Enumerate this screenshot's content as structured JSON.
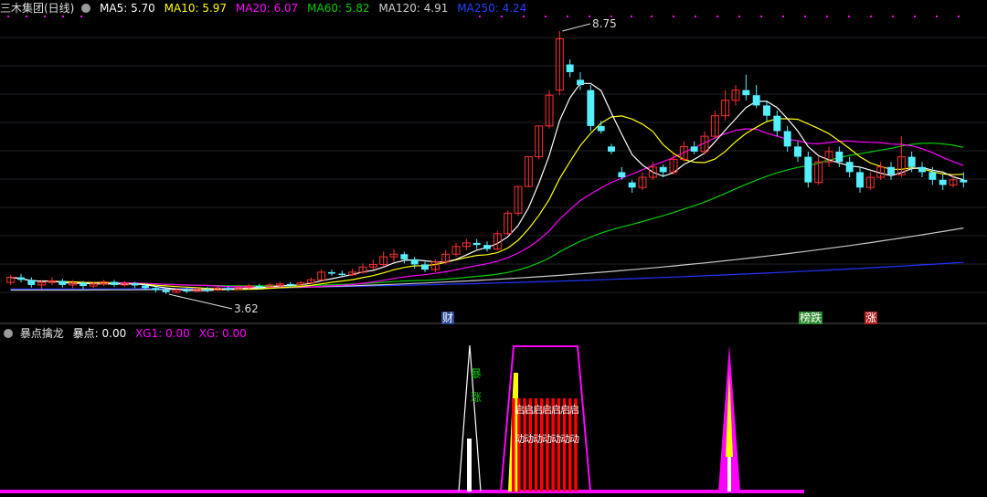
{
  "colors": {
    "ma5": "#ffffff",
    "ma10": "#ffff00",
    "ma20": "#ff00ff",
    "ma60": "#00cc00",
    "ma120": "#c8c8c8",
    "ma250": "#2233ff",
    "up_candle": "#ff3030",
    "down_candle": "#55eeff",
    "indicator_main": "#ff00ff",
    "indicator_bars": "#ff0000"
  },
  "header": {
    "stock_name": "三木集团(日线)",
    "ma5": "MA5: 5.70",
    "ma10": "MA10: 5.97",
    "ma20": "MA20: 6.07",
    "ma60": "MA60: 5.82",
    "ma120": "MA120: 4.91",
    "ma250": "MA250: 4.24"
  },
  "price_panel": {
    "high_label": "8.75",
    "low_label": "3.62",
    "event_tags": [
      "财",
      "榜跌",
      "涨"
    ]
  },
  "indicator_header": {
    "name": "暴点擒龙",
    "v1": "暴点: 0.00",
    "v2": "XG1: 0.00",
    "v3": "XG: 0.00"
  },
  "indicator_texts": {
    "vertical_top": "暴",
    "vertical_bottom": "涨",
    "qi_row": "启启启启启启启",
    "dong_row": "动动动动动动动"
  },
  "chart_data": [
    {
      "type": "candlestick",
      "title": "三木集团(日线)",
      "high_marker": 8.75,
      "low_marker": 3.62,
      "ylim": [
        3.3,
        9.0
      ],
      "series": [
        {
          "name": "MA5",
          "last": 5.7
        },
        {
          "name": "MA10",
          "last": 5.97
        },
        {
          "name": "MA20",
          "last": 6.07
        },
        {
          "name": "MA60",
          "last": 5.82
        },
        {
          "name": "MA120",
          "last": 4.91
        },
        {
          "name": "MA250",
          "last": 4.24
        }
      ],
      "candles": [
        [
          3.85,
          3.95,
          4.0,
          3.8
        ],
        [
          3.95,
          3.9,
          4.02,
          3.85
        ],
        [
          3.9,
          3.8,
          3.95,
          3.75
        ],
        [
          3.8,
          3.85,
          3.9,
          3.72
        ],
        [
          3.85,
          3.88,
          3.95,
          3.8
        ],
        [
          3.88,
          3.8,
          3.92,
          3.75
        ],
        [
          3.8,
          3.84,
          3.9,
          3.74
        ],
        [
          3.84,
          3.78,
          3.88,
          3.72
        ],
        [
          3.78,
          3.82,
          3.86,
          3.74
        ],
        [
          3.82,
          3.86,
          3.9,
          3.78
        ],
        [
          3.86,
          3.8,
          3.9,
          3.76
        ],
        [
          3.8,
          3.83,
          3.88,
          3.76
        ],
        [
          3.83,
          3.79,
          3.86,
          3.74
        ],
        [
          3.79,
          3.74,
          3.82,
          3.7
        ],
        [
          3.74,
          3.7,
          3.78,
          3.66
        ],
        [
          3.7,
          3.66,
          3.74,
          3.62
        ],
        [
          3.66,
          3.7,
          3.74,
          3.64
        ],
        [
          3.7,
          3.68,
          3.75,
          3.64
        ],
        [
          3.68,
          3.72,
          3.77,
          3.66
        ],
        [
          3.72,
          3.7,
          3.76,
          3.66
        ],
        [
          3.7,
          3.74,
          3.78,
          3.68
        ],
        [
          3.74,
          3.72,
          3.78,
          3.68
        ],
        [
          3.72,
          3.75,
          3.8,
          3.7
        ],
        [
          3.75,
          3.78,
          3.82,
          3.72
        ],
        [
          3.78,
          3.76,
          3.82,
          3.72
        ],
        [
          3.76,
          3.8,
          3.84,
          3.74
        ],
        [
          3.8,
          3.82,
          3.86,
          3.77
        ],
        [
          3.82,
          3.8,
          3.86,
          3.76
        ],
        [
          3.8,
          3.84,
          3.88,
          3.78
        ],
        [
          3.84,
          3.9,
          3.95,
          3.82
        ],
        [
          3.9,
          4.05,
          4.1,
          3.88
        ],
        [
          4.05,
          4.02,
          4.1,
          3.98
        ],
        [
          4.02,
          4.0,
          4.08,
          3.96
        ],
        [
          4.0,
          4.05,
          4.12,
          3.98
        ],
        [
          4.05,
          4.15,
          4.22,
          4.02
        ],
        [
          4.15,
          4.2,
          4.3,
          4.1
        ],
        [
          4.2,
          4.35,
          4.45,
          4.15
        ],
        [
          4.35,
          4.4,
          4.5,
          4.25
        ],
        [
          4.4,
          4.3,
          4.45,
          4.22
        ],
        [
          4.3,
          4.2,
          4.35,
          4.12
        ],
        [
          4.2,
          4.1,
          4.25,
          4.05
        ],
        [
          4.1,
          4.25,
          4.3,
          4.05
        ],
        [
          4.25,
          4.4,
          4.48,
          4.2
        ],
        [
          4.4,
          4.55,
          4.62,
          4.35
        ],
        [
          4.55,
          4.62,
          4.7,
          4.48
        ],
        [
          4.62,
          4.58,
          4.7,
          4.5
        ],
        [
          4.58,
          4.5,
          4.65,
          4.45
        ],
        [
          4.5,
          4.8,
          4.85,
          4.48
        ],
        [
          4.8,
          5.2,
          5.25,
          4.78
        ],
        [
          5.2,
          5.72,
          5.72,
          5.15
        ],
        [
          5.72,
          6.3,
          6.3,
          5.7
        ],
        [
          6.3,
          6.9,
          6.9,
          6.25
        ],
        [
          6.9,
          7.5,
          7.6,
          6.85
        ],
        [
          7.6,
          8.6,
          8.75,
          7.5
        ],
        [
          8.1,
          7.95,
          8.2,
          7.85
        ],
        [
          7.8,
          7.7,
          7.95,
          7.6
        ],
        [
          7.6,
          6.9,
          7.7,
          6.8
        ],
        [
          6.9,
          6.8,
          7.0,
          6.75
        ],
        [
          6.5,
          6.4,
          6.55,
          6.35
        ],
        [
          6.0,
          5.9,
          6.1,
          5.85
        ],
        [
          5.8,
          5.7,
          5.85,
          5.6
        ],
        [
          5.7,
          5.9,
          6.0,
          5.65
        ],
        [
          5.9,
          6.1,
          6.2,
          5.85
        ],
        [
          6.1,
          6.0,
          6.15,
          5.9
        ],
        [
          6.0,
          6.25,
          6.35,
          5.95
        ],
        [
          6.25,
          6.5,
          6.6,
          6.2
        ],
        [
          6.5,
          6.4,
          6.6,
          6.35
        ],
        [
          6.4,
          6.7,
          6.8,
          6.35
        ],
        [
          6.7,
          7.1,
          7.2,
          6.65
        ],
        [
          7.1,
          7.4,
          7.6,
          7.0
        ],
        [
          7.4,
          7.6,
          7.7,
          7.3
        ],
        [
          7.6,
          7.5,
          7.9,
          7.4
        ],
        [
          7.5,
          7.3,
          7.7,
          7.25
        ],
        [
          7.3,
          7.1,
          7.4,
          7.0
        ],
        [
          7.1,
          6.8,
          7.2,
          6.7
        ],
        [
          6.8,
          6.5,
          6.9,
          6.4
        ],
        [
          6.5,
          6.3,
          6.6,
          6.2
        ],
        [
          6.3,
          5.8,
          6.4,
          5.7
        ],
        [
          5.8,
          6.2,
          6.3,
          5.75
        ],
        [
          6.2,
          6.4,
          6.5,
          6.1
        ],
        [
          6.4,
          6.2,
          6.5,
          6.1
        ],
        [
          6.2,
          6.0,
          6.3,
          5.9
        ],
        [
          6.0,
          5.7,
          6.1,
          5.6
        ],
        [
          5.7,
          5.9,
          6.0,
          5.65
        ],
        [
          5.9,
          6.1,
          6.2,
          5.85
        ],
        [
          6.1,
          5.95,
          6.2,
          5.85
        ],
        [
          5.95,
          6.3,
          6.7,
          5.9
        ],
        [
          6.3,
          6.1,
          6.4,
          6.0
        ],
        [
          6.1,
          6.0,
          6.2,
          5.9
        ],
        [
          6.0,
          5.85,
          6.1,
          5.75
        ],
        [
          5.85,
          5.75,
          5.95,
          5.65
        ],
        [
          5.75,
          5.85,
          5.95,
          5.7
        ],
        [
          5.85,
          5.8,
          6.0,
          5.7
        ]
      ]
    },
    {
      "type": "area",
      "title": "暴点擒龙",
      "series": [
        {
          "name": "暴点",
          "last": 0.0
        },
        {
          "name": "XG1",
          "last": 0.0
        },
        {
          "name": "XG",
          "last": 0.0
        }
      ]
    }
  ]
}
